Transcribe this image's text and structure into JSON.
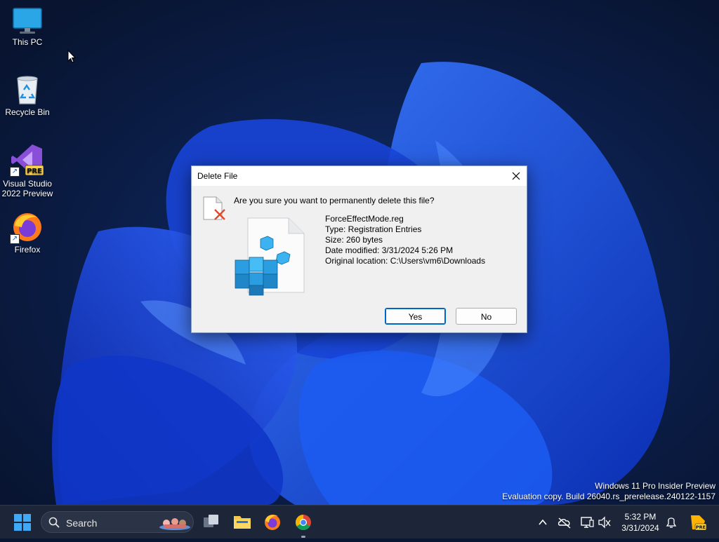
{
  "desktop": {
    "icons": [
      {
        "label": "This PC"
      },
      {
        "label": "Recycle Bin"
      },
      {
        "label": "Visual Studio 2022 Preview",
        "badge": "PRE"
      },
      {
        "label": "Firefox"
      }
    ],
    "watermark": {
      "line1": "Windows 11 Pro Insider Preview",
      "line2": "Evaluation copy. Build 26040.rs_prerelease.240122-1157"
    }
  },
  "dialog": {
    "title": "Delete File",
    "question": "Are you sure you want to permanently delete this file?",
    "file_name": "ForceEffectMode.reg",
    "type": "Type: Registration Entries",
    "size": "Size: 260 bytes",
    "date_modified": "Date modified: 3/31/2024 5:26 PM",
    "original_location": "Original location: C:\\Users\\vm6\\Downloads",
    "yes_label": "Yes",
    "no_label": "No"
  },
  "taskbar": {
    "search_label": "Search",
    "clock_time": "5:32 PM",
    "clock_date": "3/31/2024",
    "tray_badge": "PRE"
  },
  "colors": {
    "accent": "#0067c0",
    "wallpaper_bloom": "#1f4fe0",
    "taskbar": "#1c2638"
  }
}
